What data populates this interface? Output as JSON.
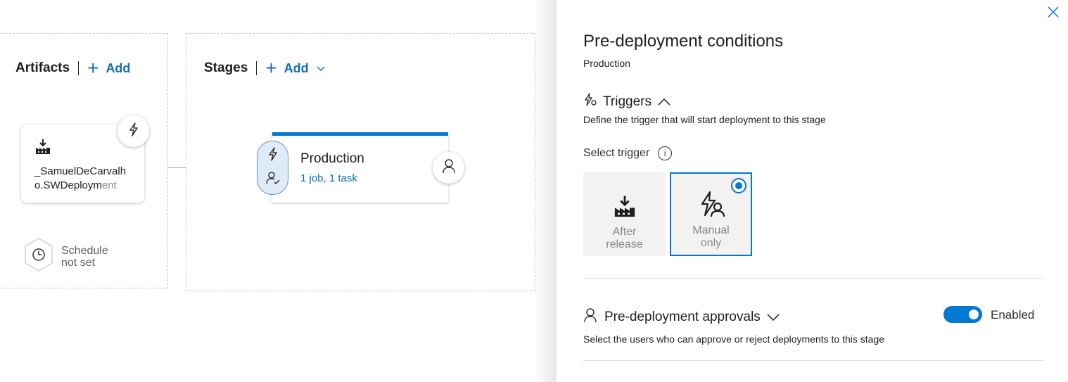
{
  "canvas": {
    "artifacts": {
      "title": "Artifacts",
      "add_label": "Add"
    },
    "stages": {
      "title": "Stages",
      "add_label": "Add"
    },
    "artifact": {
      "name_line1": "_SamuelDeCarvalh",
      "name_line2_main": "o.SWDeploym",
      "name_line2_faded": "ent"
    },
    "schedule": {
      "line1": "Schedule",
      "line2": "not set"
    },
    "stage": {
      "name": "Production",
      "summary": "1 job, 1 task"
    }
  },
  "panel": {
    "title": "Pre-deployment conditions",
    "subtitle": "Production",
    "triggers": {
      "heading": "Triggers",
      "description": "Define the trigger that will start deployment to this stage",
      "select_label": "Select trigger",
      "options": [
        {
          "line1": "After",
          "line2": "release",
          "selected": false
        },
        {
          "line1": "Manual",
          "line2": "only",
          "selected": true
        }
      ]
    },
    "approvals": {
      "heading": "Pre-deployment approvals",
      "description": "Select the users who can approve or reject deployments to this stage",
      "toggle_label": "Enabled",
      "enabled": true
    }
  },
  "colors": {
    "accent": "#0078d4",
    "link": "#106ebe",
    "tile_bg": "#f3f2f1"
  },
  "icons": [
    "plus-icon",
    "chevron-down-icon",
    "build-icon",
    "lightning-icon",
    "clock-icon",
    "user-icon",
    "user-check-icon",
    "close-icon",
    "trigger-icon",
    "chevron-up-icon",
    "info-icon",
    "manual-trigger-icon"
  ]
}
